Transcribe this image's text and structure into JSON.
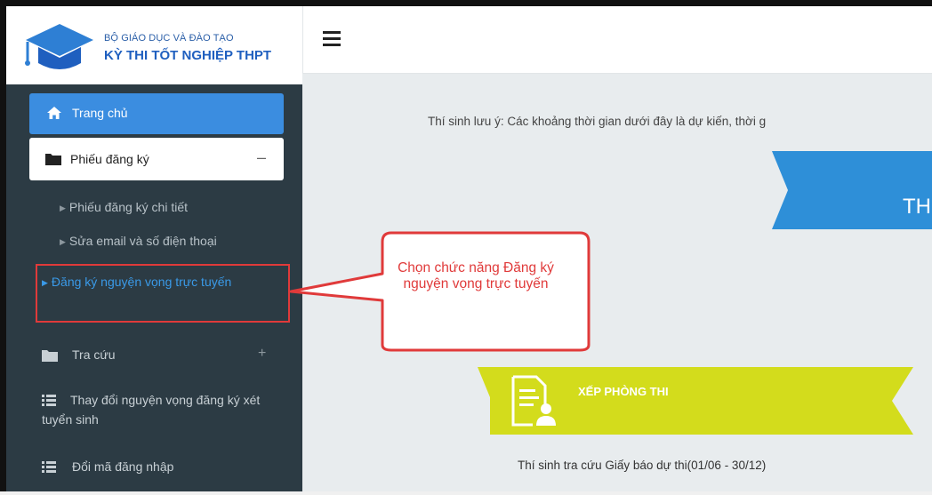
{
  "brand": {
    "line1": "BỘ GIÁO DỤC VÀ ĐÀO TẠO",
    "line2": "KỲ THI TỐT NGHIỆP THPT"
  },
  "sidebar": {
    "home": {
      "label": "Trang chủ",
      "icon": "home-icon"
    },
    "registration": {
      "label": "Phiếu đăng ký",
      "icon": "folder-icon",
      "toggle": "–",
      "items": [
        {
          "label": "Phiếu đăng ký chi tiết"
        },
        {
          "label": "Sửa email và số điện thoại"
        },
        {
          "label": "Đăng ký nguyện vọng trực tuyến"
        }
      ]
    },
    "lookup": {
      "label": "Tra cứu",
      "icon": "folder-icon",
      "toggle": "+"
    },
    "change_wishes": {
      "label": "Thay đổi nguyện vọng đăng ký xét tuyển sinh",
      "icon": "list-icon"
    },
    "change_password": {
      "label": "Đổi mã đăng nhập",
      "icon": "list-icon"
    }
  },
  "topbar": {
    "menu_icon": "hamburger-icon"
  },
  "content": {
    "notice": "Thí sinh lưu ý: Các khoảng thời gian dưới đây là dự kiến, thời g",
    "blue_banner_text": "TH",
    "exam_room": {
      "label": "XẾP PHÒNG THI",
      "caption": "Thí sinh tra cứu Giấy báo dự thi(01/06 - 30/12)",
      "icon": "document-user-icon"
    }
  },
  "callout": {
    "text": "Chọn chức năng Đăng ký nguyện vọng trực tuyến"
  },
  "colors": {
    "sidebar_bg": "#2c3b44",
    "active_blue": "#3b8de0",
    "content_bg": "#e8ecee",
    "banner_blue": "#2e8fd8",
    "banner_green": "#d3dc1c",
    "callout_red": "#e03a3a"
  }
}
